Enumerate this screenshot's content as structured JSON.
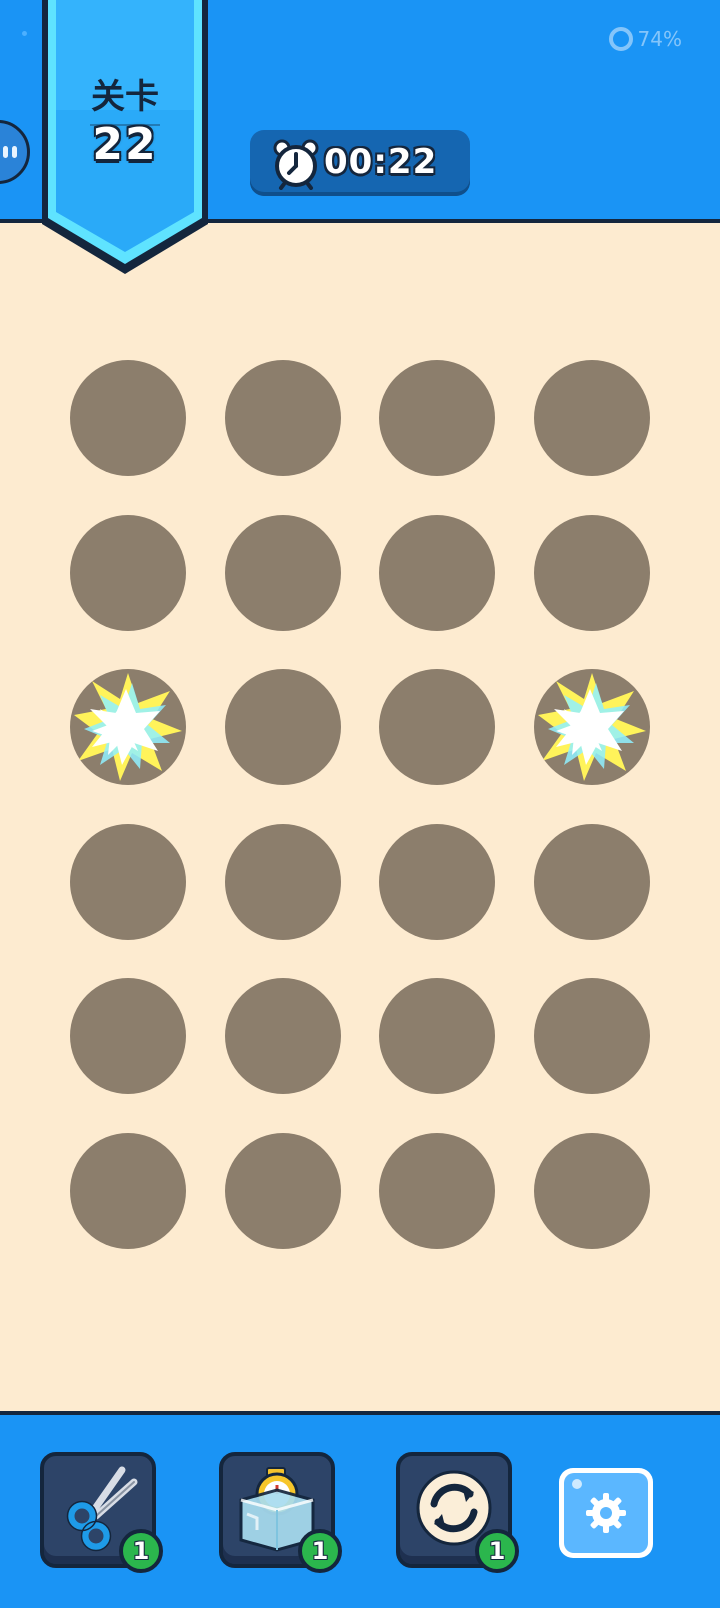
{
  "header": {
    "status_progress": "74%",
    "level_label": "关卡",
    "level_number": "22",
    "timer": "00:22",
    "timer_icon": "alarm-clock-icon"
  },
  "board": {
    "rows": 6,
    "cols": 4,
    "hole_color": "#8c7e6c",
    "burst_holes": [
      {
        "row": 3,
        "col": 1
      },
      {
        "row": 3,
        "col": 4
      }
    ]
  },
  "toolbar": {
    "tools": [
      {
        "name": "scissors",
        "icon": "scissors-icon",
        "count": "1"
      },
      {
        "name": "freeze",
        "icon": "ice-cube-timer-icon",
        "count": "1"
      },
      {
        "name": "shuffle",
        "icon": "refresh-icon",
        "count": "1"
      }
    ],
    "settings_icon": "gear-icon"
  },
  "colors": {
    "bar_blue": "#1a94f5",
    "background": "#fdebd0",
    "outline": "#14263d",
    "badge_green": "#2bb64d"
  }
}
